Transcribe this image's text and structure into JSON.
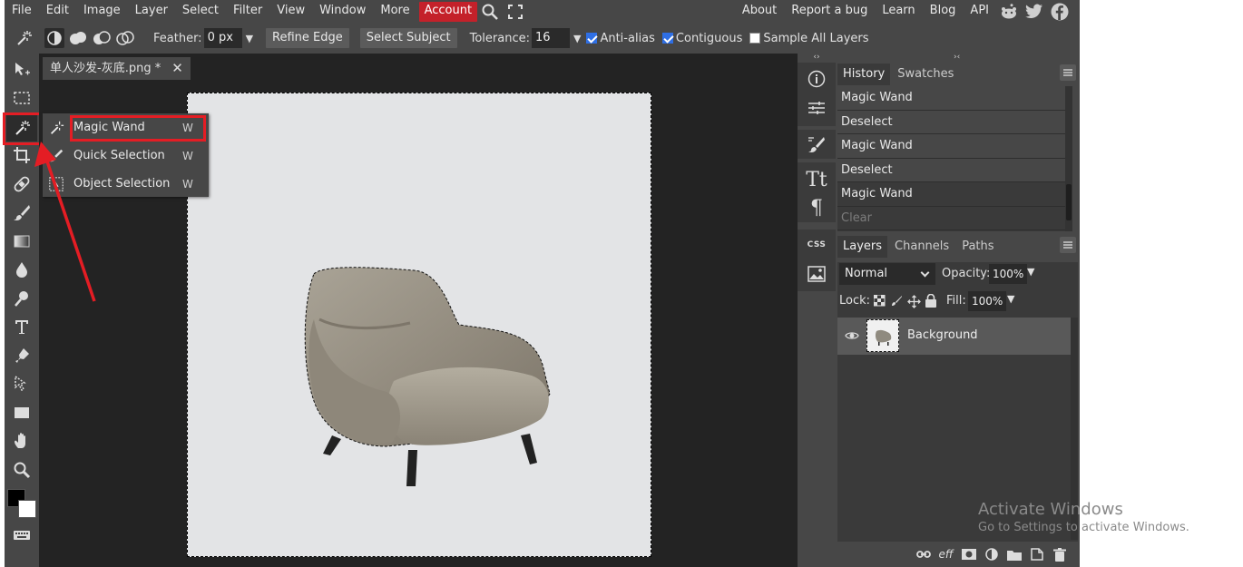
{
  "menu": {
    "items": [
      "File",
      "Edit",
      "Image",
      "Layer",
      "Select",
      "Filter",
      "View",
      "Window",
      "More"
    ],
    "account": "Account",
    "right_links": [
      "About",
      "Report a bug",
      "Learn",
      "Blog",
      "API"
    ]
  },
  "options": {
    "feather_label": "Feather:",
    "feather_value": "0 px",
    "refine_edge": "Refine Edge",
    "select_subject": "Select Subject",
    "tolerance_label": "Tolerance:",
    "tolerance_value": "16",
    "anti_alias": "Anti-alias",
    "contiguous": "Contiguous",
    "sample_all_layers": "Sample All Layers"
  },
  "document": {
    "tab_title": "单人沙发-灰底.png *",
    "close_glyph": "✕"
  },
  "flyout": {
    "items": [
      {
        "name": "Magic Wand",
        "key": "W"
      },
      {
        "name": "Quick Selection",
        "key": "W"
      },
      {
        "name": "Object Selection",
        "key": "W"
      }
    ]
  },
  "sidecol": {
    "css_label": "CSS"
  },
  "history_panel": {
    "tabs": [
      "History",
      "Swatches"
    ],
    "items": [
      "Magic Wand",
      "Deselect",
      "Magic Wand",
      "Deselect",
      "Magic Wand",
      "Clear"
    ]
  },
  "layers_panel": {
    "tabs": [
      "Layers",
      "Channels",
      "Paths"
    ],
    "blend_mode": "Normal",
    "opacity_label": "Opacity:",
    "opacity_value": "100%",
    "lock_label": "Lock:",
    "fill_label": "Fill:",
    "fill_value": "100%",
    "layer_name": "Background",
    "footer_eff": "eff"
  },
  "watermark": {
    "line1": "Activate Windows",
    "line2": "Go to Settings to activate Windows."
  },
  "colors": {
    "account_red": "#c4212a",
    "annotation_red": "#e41d24",
    "checkbox_blue": "#2f6fe4"
  }
}
